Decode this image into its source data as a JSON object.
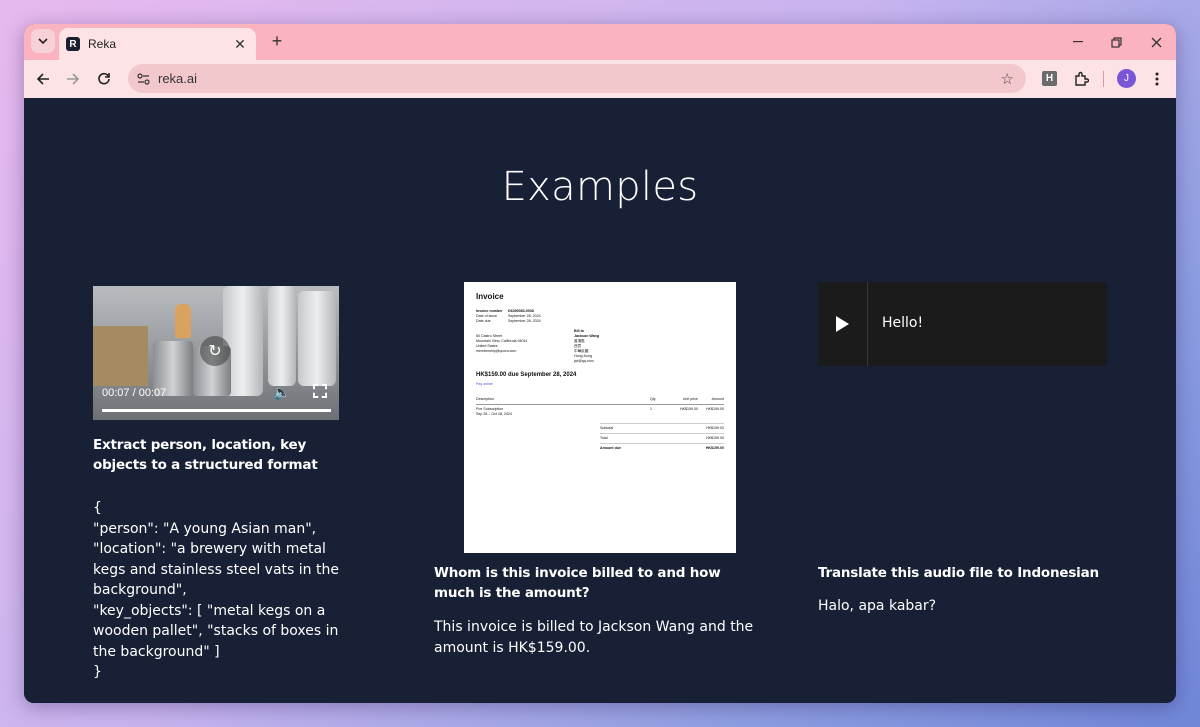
{
  "browser": {
    "tab_title": "Reka",
    "favicon_letter": "R",
    "url": "reka.ai",
    "extension_letter": "H",
    "profile_initial": "J",
    "icons": [
      "tab-search-icon",
      "close-icon",
      "new-tab-icon",
      "minimize-icon",
      "restore-icon",
      "close-window-icon",
      "back-icon",
      "forward-icon",
      "reload-icon",
      "site-info-icon",
      "bookmark-star-icon",
      "extensions-icon",
      "menu-icon"
    ]
  },
  "page": {
    "heading": "Examples",
    "examples": [
      {
        "media": "video",
        "video_time": "00:07 / 00:07",
        "question": "Extract person, location, key objects to a structured format",
        "answer_lines": [
          "{",
          "\"person\": \"A young Asian man\",",
          "\"location\": \"a brewery with metal kegs and stainless steel vats in the background\",",
          "\"key_objects\": [ \"metal kegs on a wooden pallet\", \"stacks of boxes in the background\" ]",
          "}"
        ]
      },
      {
        "media": "image",
        "invoice": {
          "title": "Invoice",
          "number_label": "Invoice number",
          "number": "D6390083-0008",
          "issue_label": "Date of issue",
          "issue_date": "September 28, 2024",
          "due_label": "Date due",
          "due_date": "September 28, 2024",
          "from_lines": [
            "60 Castro Street",
            "Mountain View, California 94041",
            "United States",
            "membership@quora.com"
          ],
          "bill_to_label": "Bill to",
          "bill_to_lines": [
            "Jackson Wang",
            "香港區",
            "西貢",
            "中華民國",
            "Hong Kong",
            "jwi@qq.com"
          ],
          "amount_due_line": "HK$159.00 due September 28, 2024",
          "pay_online": "Pay online",
          "columns": [
            "Description",
            "Qty",
            "Unit price",
            "Amount"
          ],
          "item_desc": "Poe Subscription",
          "item_period": "Sep 28 – Oct 28, 2024",
          "item_qty": "1",
          "item_unit": "HK$159.00",
          "item_amount": "HK$159.00",
          "subtotal_label": "Subtotal",
          "subtotal": "HK$159.00",
          "total_label": "Total",
          "total": "HK$159.00",
          "amount_due_label": "Amount due",
          "amount_due": "HK$159.00"
        },
        "question": "Whom is this invoice billed to and how much is the amount?",
        "answer": "This invoice is billed to Jackson Wang and the amount is HK$159.00."
      },
      {
        "media": "audio",
        "audio_label": "Hello!",
        "question": "Translate this audio file to Indonesian",
        "answer": "Halo, apa kabar?"
      }
    ]
  }
}
